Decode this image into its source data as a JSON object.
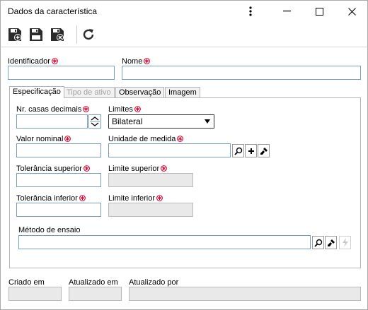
{
  "window": {
    "title": "Dados da característica"
  },
  "icons": {
    "menu": "kebab-menu-icon",
    "minimize": "minimize-icon",
    "maximize": "maximize-icon",
    "close": "close-icon",
    "save_new": "save-and-new-icon",
    "save": "save-icon",
    "save_close": "save-and-close-icon",
    "refresh": "refresh-icon",
    "required": "required-asterisk-icon",
    "search": "search-icon",
    "add": "plus-icon",
    "clear": "eraser-icon",
    "flash": "lightning-icon"
  },
  "colors": {
    "required": "#e0002a",
    "border_input": "#7a9cc6",
    "readonly_bg": "#e9e9e9"
  },
  "header": {
    "identificador_label": "Identificador",
    "identificador_value": "",
    "nome_label": "Nome",
    "nome_value": ""
  },
  "tabs": [
    {
      "label": "Especificação",
      "active": true
    },
    {
      "label": "Tipo de ativo",
      "active": false,
      "disabled": true
    },
    {
      "label": "Observação",
      "active": false
    },
    {
      "label": "Imagem",
      "active": false
    }
  ],
  "spec": {
    "casas_label": "Nr. casas decimais",
    "casas_value": "",
    "limites_label": "Limites",
    "limites_value": "Bilateral",
    "valor_nominal_label": "Valor nominal",
    "unidade_label": "Unidade de medida",
    "tol_sup_label": "Tolerância superior",
    "lim_sup_label": "Limite superior",
    "tol_inf_label": "Tolerância inferior",
    "lim_inf_label": "Limite inferior",
    "metodo_label": "Método de ensaio"
  },
  "footer": {
    "criado_label": "Criado em",
    "atualizado_label": "Atualizado em",
    "atualizado_por_label": "Atualizado por"
  }
}
